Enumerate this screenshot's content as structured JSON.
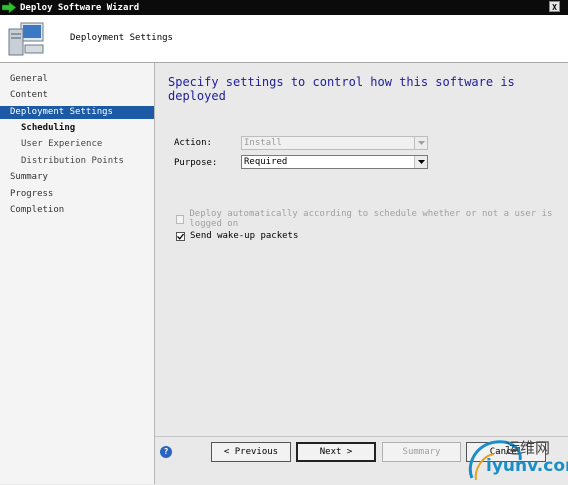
{
  "window": {
    "title": "Deploy Software Wizard",
    "close_glyph": "X"
  },
  "header": {
    "title": "Deployment Settings",
    "icon": "computer-icon"
  },
  "sidebar": {
    "items": [
      {
        "label": "General"
      },
      {
        "label": "Content"
      },
      {
        "label": "Deployment Settings"
      },
      {
        "label": "Scheduling"
      },
      {
        "label": "User Experience"
      },
      {
        "label": "Distribution Points"
      },
      {
        "label": "Summary"
      },
      {
        "label": "Progress"
      },
      {
        "label": "Completion"
      }
    ]
  },
  "main": {
    "heading": "Specify settings to control how this software is deployed",
    "action_label": "Action:",
    "action_value": "Install",
    "purpose_label": "Purpose:",
    "purpose_value": "Required",
    "auto_deploy_label": "Deploy automatically according to schedule whether or not a user is logged on",
    "auto_deploy_checked": false,
    "wakeup_label": "Send wake-up packets",
    "wakeup_checked": true
  },
  "footer": {
    "help_glyph": "?",
    "previous_label": "< Previous",
    "next_label": "Next >",
    "summary_label": "Summary",
    "cancel_label": "Cancel"
  },
  "watermark": {
    "chinese_text": "运维网",
    "url_text": "iyunv.com"
  },
  "colors": {
    "active_nav": "#1d5aa5",
    "heading": "#20209a",
    "titlebar": "#0b0b0b"
  }
}
